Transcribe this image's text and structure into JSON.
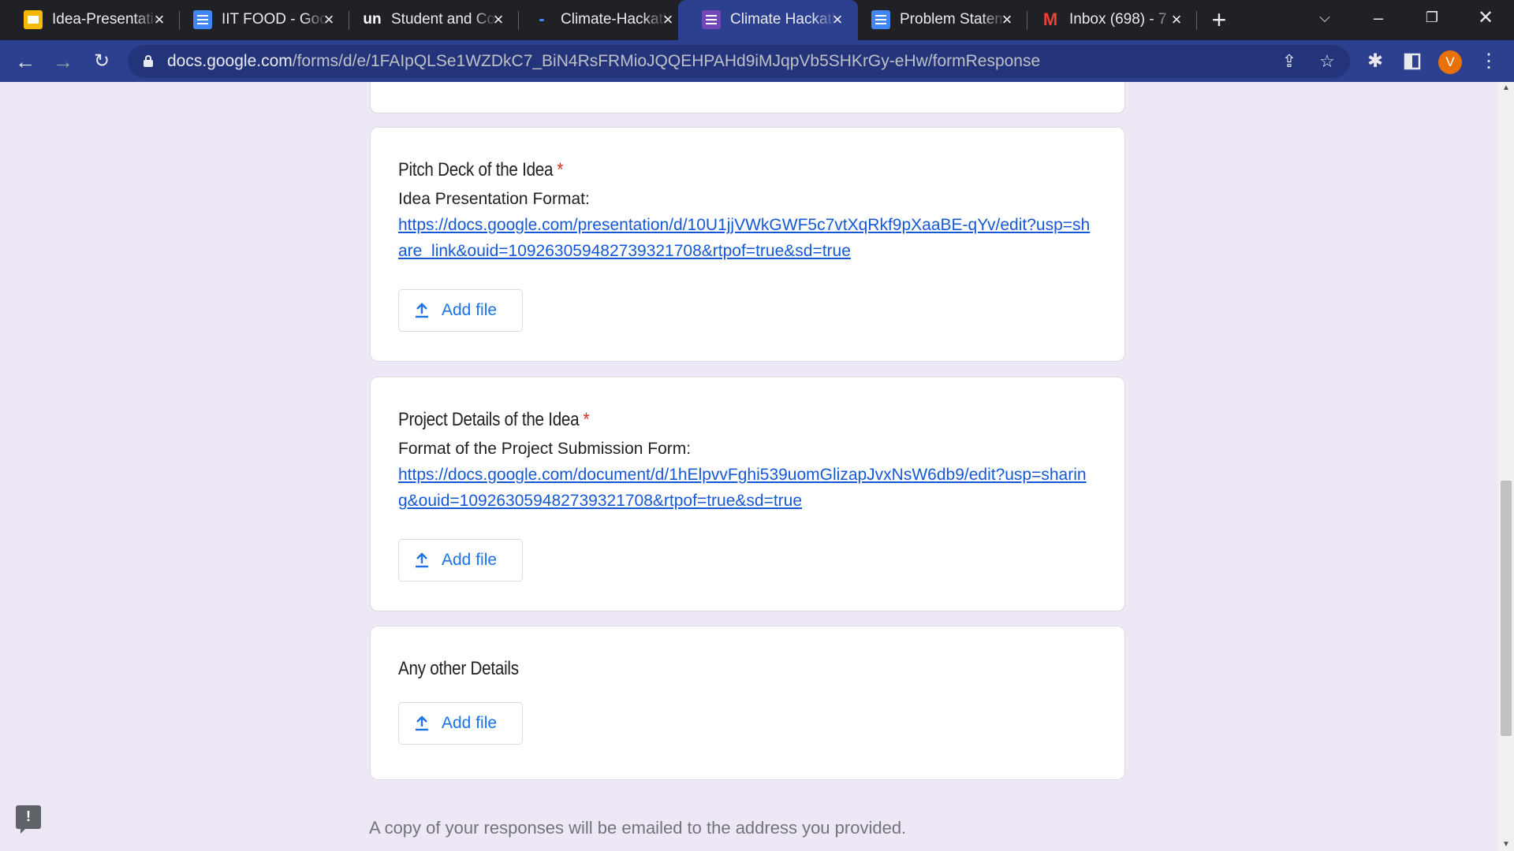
{
  "browser": {
    "tabs": [
      {
        "title": "Idea-Presentation",
        "icon": "slides-icon",
        "active": false
      },
      {
        "title": "IIT FOOD - Google Docs",
        "icon": "docs-icon",
        "active": false
      },
      {
        "title": "Student and Community",
        "icon": "un-icon",
        "active": false
      },
      {
        "title": "Climate-Hackathon",
        "icon": "page-icon",
        "active": false
      },
      {
        "title": "Climate Hackathon",
        "icon": "forms-icon",
        "active": true
      },
      {
        "title": "Problem Statements",
        "icon": "docs-icon",
        "active": false
      },
      {
        "title": "Inbox (698) - 7",
        "icon": "gmail-icon",
        "active": false
      }
    ],
    "url_domain": "docs.google.com",
    "url_path": "/forms/d/e/1FAIpQLSe1WZDkC7_BiN4RsFRMioJQQEHPAHd9iMJqpVb5SHKrGy-eHw/formResponse",
    "profile_initial": "V",
    "accent_color": "#2d3f8f"
  },
  "form": {
    "questions": [
      {
        "title": "Pitch Deck of the Idea",
        "required_mark": "*",
        "description": "Idea Presentation Format:",
        "link": "https://docs.google.com/presentation/d/10U1jjVWkGWF5c7vtXqRkf9pXaaBE-qYv/edit?usp=share_link&ouid=109263059482739321708&rtpof=true&sd=true",
        "button": "Add file"
      },
      {
        "title": "Project Details of the Idea",
        "required_mark": "*",
        "description": "Format of the Project Submission Form:",
        "link": "https://docs.google.com/document/d/1hElpvvFghi539uomGlizapJvxNsW6db9/edit?usp=sharing&ouid=109263059482739321708&rtpof=true&sd=true",
        "button": "Add file"
      },
      {
        "title": "Any other Details",
        "required_mark": "",
        "button": "Add file"
      }
    ],
    "footer_note": "A copy of your responses will be emailed to the address you provided.",
    "feedback_glyph": "!"
  }
}
